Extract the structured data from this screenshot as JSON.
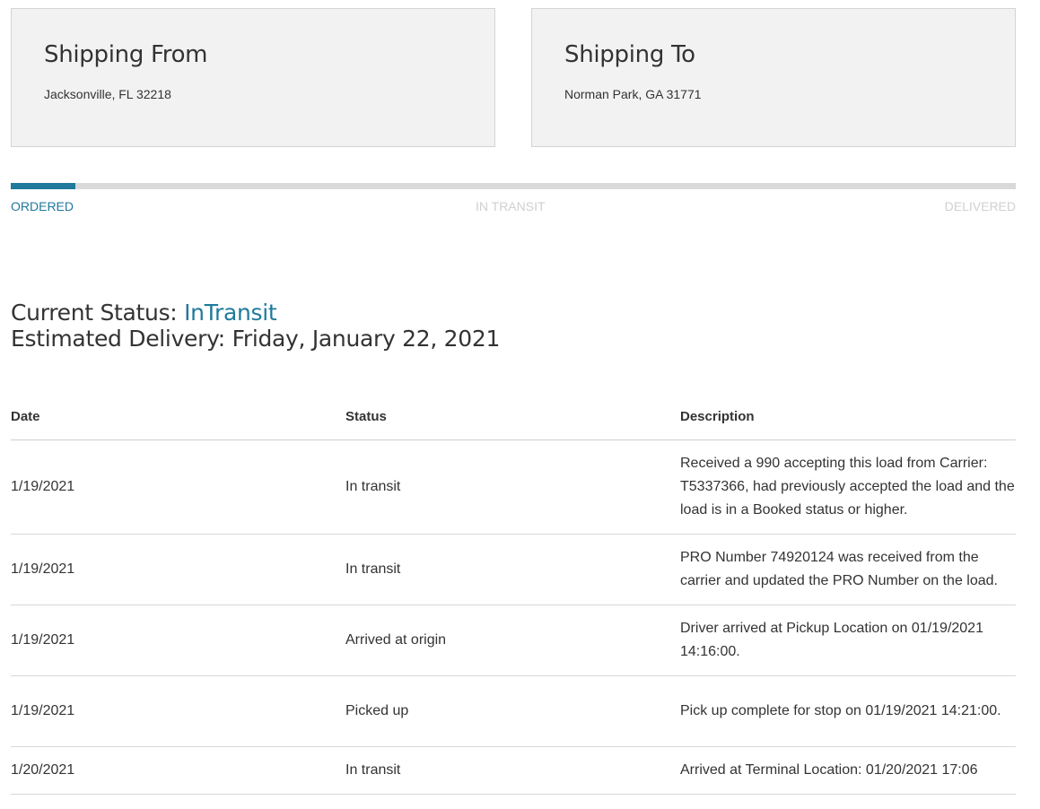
{
  "shipping_from": {
    "title": "Shipping From",
    "address": "Jacksonville, FL 32218"
  },
  "shipping_to": {
    "title": "Shipping To",
    "address": "Norman Park, GA 31771"
  },
  "progress": {
    "steps": [
      "ORDERED",
      "IN TRANSIT",
      "DELIVERED"
    ],
    "active_step": "ORDERED",
    "fraction_complete": 0.064
  },
  "status": {
    "current_label": "Current Status: ",
    "current_value": "InTransit",
    "delivery_label": "Estimated Delivery: ",
    "delivery_value": "Friday, January 22, 2021"
  },
  "history": {
    "headers": {
      "date": "Date",
      "status": "Status",
      "description": "Description"
    },
    "rows": [
      {
        "date": "1/19/2021",
        "status": "In transit",
        "description": "Received a 990 accepting this load from Carrier: T5337366, had previously accepted the load and the load is in a Booked status or higher."
      },
      {
        "date": "1/19/2021",
        "status": "In transit",
        "description": "PRO Number 74920124 was received from the carrier and updated the PRO Number on the load."
      },
      {
        "date": "1/19/2021",
        "status": "Arrived at origin",
        "description": "Driver arrived at Pickup Location on 01/19/2021 14:16:00."
      },
      {
        "date": "1/19/2021",
        "status": "Picked up",
        "description": "Pick up complete for stop on 01/19/2021 14:21:00."
      },
      {
        "date": "1/20/2021",
        "status": "In transit",
        "description": "Arrived at Terminal Location: 01/20/2021 17:06"
      }
    ]
  },
  "colors": {
    "accent": "#1f7a9c",
    "card_bg": "#f2f2f2",
    "inactive_step": "#d0d0d0"
  }
}
